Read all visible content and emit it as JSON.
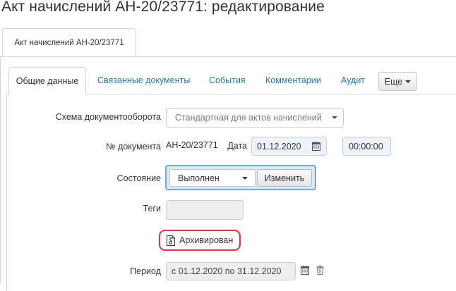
{
  "page": {
    "title": "Акт начислений АН-20/23771: редактирование"
  },
  "doc_tab": {
    "label": "Акт начислений АН-20/23771"
  },
  "tabs": [
    {
      "label": "Общие данные"
    },
    {
      "label": "Связанные документы"
    },
    {
      "label": "События"
    },
    {
      "label": "Комментарии"
    },
    {
      "label": "Аудит"
    }
  ],
  "more_button": {
    "label": "Еще"
  },
  "form": {
    "workflow": {
      "label": "Схема документооборота",
      "value": "Стандартная для актов начислений"
    },
    "doc_number": {
      "label": "№ документа",
      "value": "АН-20/23771"
    },
    "date": {
      "label": "Дата",
      "value": "01.12.2020"
    },
    "time": {
      "value": "00:00:00"
    },
    "state": {
      "label": "Состояние",
      "value": "Выполнен",
      "change_label": "Изменить"
    },
    "tags": {
      "label": "Теги",
      "value": ""
    },
    "archived": {
      "label": "Архивирован"
    },
    "period": {
      "label": "Период",
      "value": "с 01.12.2020 по 31.12.2020"
    }
  },
  "icons": {
    "calendar": "calendar-icon",
    "trash": "trash-icon",
    "archive": "archive-document-icon",
    "dropdown": "chevron-down-icon"
  },
  "colors": {
    "link": "#1f77b4",
    "highlight_border": "#e0353a",
    "state_frame": "#7ba7d6"
  }
}
